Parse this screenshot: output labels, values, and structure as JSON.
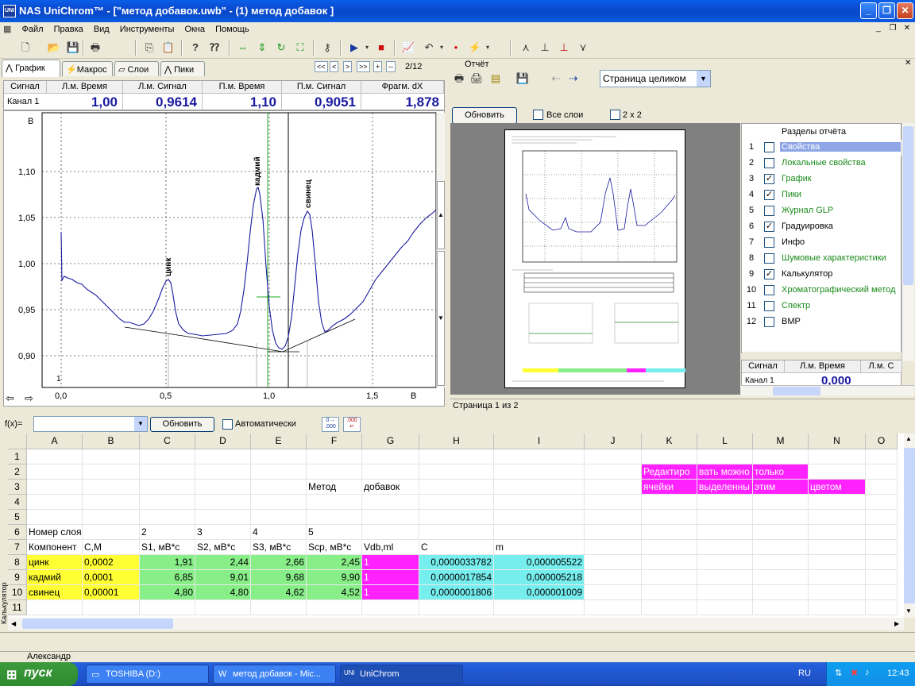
{
  "window": {
    "title": "NAS UniChrom™ - [\"метод добавок.uwb\" - (1) метод добавок ]",
    "icon": "UNI"
  },
  "menu": [
    "Файл",
    "Правка",
    "Вид",
    "Инструменты",
    "Окна",
    "Помощь"
  ],
  "left": {
    "tabs": [
      "График",
      "Макрос",
      "Слои",
      "Пики"
    ],
    "nav": [
      "<<",
      "<",
      ">",
      ">>",
      "+",
      "--"
    ],
    "page_counter": "2/12",
    "signal_table": {
      "headers": [
        "Сигнал",
        "Л.м. Время",
        "Л.м. Сигнал",
        "П.м. Время",
        "П.м. Сигнал",
        "Фрагм. dX"
      ],
      "row_label": "Канал 1",
      "values": [
        "1,00",
        "0,9614",
        "1,10",
        "0,9051",
        "1,878"
      ]
    },
    "graph": {
      "y_unit": "В",
      "x_unit": "В",
      "y_ticks": [
        "1,10",
        "1,05",
        "1,00",
        "0,95",
        "0,90"
      ],
      "x_ticks": [
        "0,0",
        "0,5",
        "1,0",
        "1,5"
      ],
      "peak_labels": [
        "цинк",
        "кадмий",
        "свинец"
      ],
      "corner_label": "1"
    }
  },
  "right": {
    "title": "Отчёт",
    "page_select": "Страница целиком",
    "refresh_button": "Обновить",
    "all_layers": "Все слои",
    "grid_2x2": "2 x 2",
    "sections_header": "Разделы отчёта",
    "sections": [
      {
        "n": "1",
        "label": "Свойства",
        "checked": false,
        "color": "#1a8a1a",
        "selected": true
      },
      {
        "n": "2",
        "label": "Локальные свойства",
        "checked": false,
        "color": "#1a8a1a"
      },
      {
        "n": "3",
        "label": "График",
        "checked": true,
        "color": "#1a8a1a"
      },
      {
        "n": "4",
        "label": "Пики",
        "checked": true,
        "color": "#1a8a1a"
      },
      {
        "n": "5",
        "label": "Журнал GLP",
        "checked": false,
        "color": "#1a8a1a"
      },
      {
        "n": "6",
        "label": "Градуировка",
        "checked": true,
        "color": "#000000"
      },
      {
        "n": "7",
        "label": "Инфо",
        "checked": false,
        "color": "#000000"
      },
      {
        "n": "8",
        "label": "Шумовые характеристики",
        "checked": false,
        "color": "#1a8a1a"
      },
      {
        "n": "9",
        "label": "Калькулятор",
        "checked": true,
        "color": "#000000"
      },
      {
        "n": "10",
        "label": "Хроматографический метод",
        "checked": false,
        "color": "#1a8a1a"
      },
      {
        "n": "11",
        "label": "Спектр",
        "checked": false,
        "color": "#1a8a1a"
      },
      {
        "n": "12",
        "label": "BMP",
        "checked": false,
        "color": "#000000"
      }
    ],
    "mini_signal": {
      "headers": [
        "Сигнал",
        "Л.м. Время",
        "Л.м. С"
      ],
      "row_label": "Канал 1",
      "value": "0,000"
    },
    "status": "Страница 1 из 2"
  },
  "formula": {
    "label": "f(x)=",
    "refresh": "Обновить",
    "auto": "Автоматически"
  },
  "sheet": {
    "columns": [
      "A",
      "B",
      "C",
      "D",
      "E",
      "F",
      "G",
      "H",
      "I",
      "J",
      "K",
      "L",
      "M",
      "N",
      "O"
    ],
    "rows": [
      "1",
      "2",
      "3",
      "4",
      "5",
      "6",
      "7",
      "8",
      "9",
      "10",
      "11"
    ],
    "side_label": "Калькулятор",
    "notes": {
      "k2": "Редактиро",
      "l2": "вать можно",
      "m2": "только",
      "k3": "ячейки",
      "l3": "выделенны",
      "m3": "этим",
      "n3": "цветом"
    },
    "method": {
      "f3": "Метод",
      "g3": "добавок"
    },
    "row6": {
      "a": "Номер слоя",
      "c": "2",
      "d": "3",
      "e": "4",
      "f": "5"
    },
    "row7": {
      "a": "Компонент",
      "b": "C,M",
      "c": "S1, мВ*с",
      "d": "S2, мВ*с",
      "e": "S3, мВ*с",
      "f": "Scp, мВ*с",
      "g": "Vdb,ml",
      "h": "C",
      "i": "m"
    },
    "data": [
      {
        "a": "цинк",
        "b": "0,0002",
        "c": "1,91",
        "d": "2,44",
        "e": "2,66",
        "f": "2,45",
        "g": "1",
        "h": "0,0000033782",
        "i": "0,000005522"
      },
      {
        "a": "кадмий",
        "b": "0,0001",
        "c": "6,85",
        "d": "9,01",
        "e": "9,68",
        "f": "9,90",
        "g": "1",
        "h": "0,0000017854",
        "i": "0,000005218"
      },
      {
        "a": "свинец",
        "b": "0,00001",
        "c": "4,80",
        "d": "4,80",
        "e": "4,62",
        "f": "4,52",
        "g": "1",
        "h": "0,0000001806",
        "i": "0,000001009"
      }
    ]
  },
  "status_user": "Александр",
  "taskbar": {
    "start": "пуск",
    "tasks": [
      "TOSHIBA (D:)",
      "метод добавок - Mic...",
      "UniChrom"
    ],
    "lang": "RU",
    "clock": "12:43"
  }
}
